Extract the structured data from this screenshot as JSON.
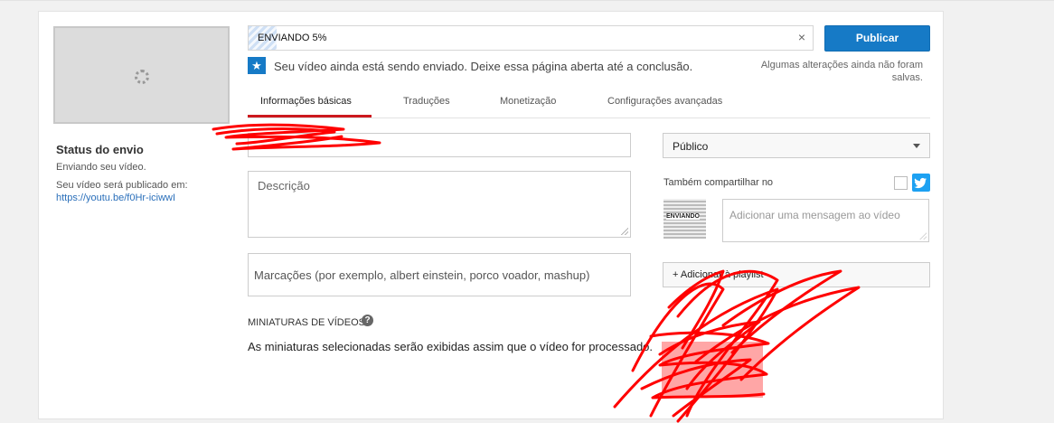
{
  "upload": {
    "progress_label": "ENVIANDO 5%",
    "progress_fraction": 0.05,
    "close_glyph": "×",
    "close_icon": "close-icon"
  },
  "toolbar": {
    "publish_label": "Publicar"
  },
  "notice": {
    "icon": "star-icon",
    "icon_glyph": "★",
    "text": "Seu vídeo ainda está sendo enviado. Deixe essa página aberta até a conclusão.",
    "saved_note": "Algumas alterações ainda não foram salvas."
  },
  "tabs": [
    {
      "label": "Informações básicas",
      "active": true
    },
    {
      "label": "Traduções",
      "active": false
    },
    {
      "label": "Monetização",
      "active": false
    },
    {
      "label": "Configurações avançadas",
      "active": false
    }
  ],
  "status": {
    "title": "Status do envio",
    "line": "Enviando seu vídeo.",
    "published_at_label": "Seu vídeo será publicado em:",
    "link": "https://youtu.be/f0Hr-iciwwI"
  },
  "form": {
    "title_value": "",
    "description_placeholder": "Descrição",
    "tags_placeholder": "Marcações (por exemplo, albert einstein, porco voador, mashup)"
  },
  "privacy": {
    "selected": "Público",
    "icon": "chevron-down-icon"
  },
  "share": {
    "label": "Também compartilhar no",
    "twitter_icon": "twitter-icon",
    "message_placeholder": "Adicionar uma mensagem ao vídeo",
    "thumb_text": "ENVIANDO"
  },
  "playlist": {
    "label": "+ Adicionar à playlist"
  },
  "thumbnails": {
    "title": "MINIATURAS DE VÍDEOS",
    "help_glyph": "?",
    "description": "As miniaturas selecionadas serão exibidas assim que o vídeo for processado."
  },
  "colors": {
    "accent": "#167ac6",
    "tab_active": "#cc181e",
    "redaction": "#ff0000"
  }
}
